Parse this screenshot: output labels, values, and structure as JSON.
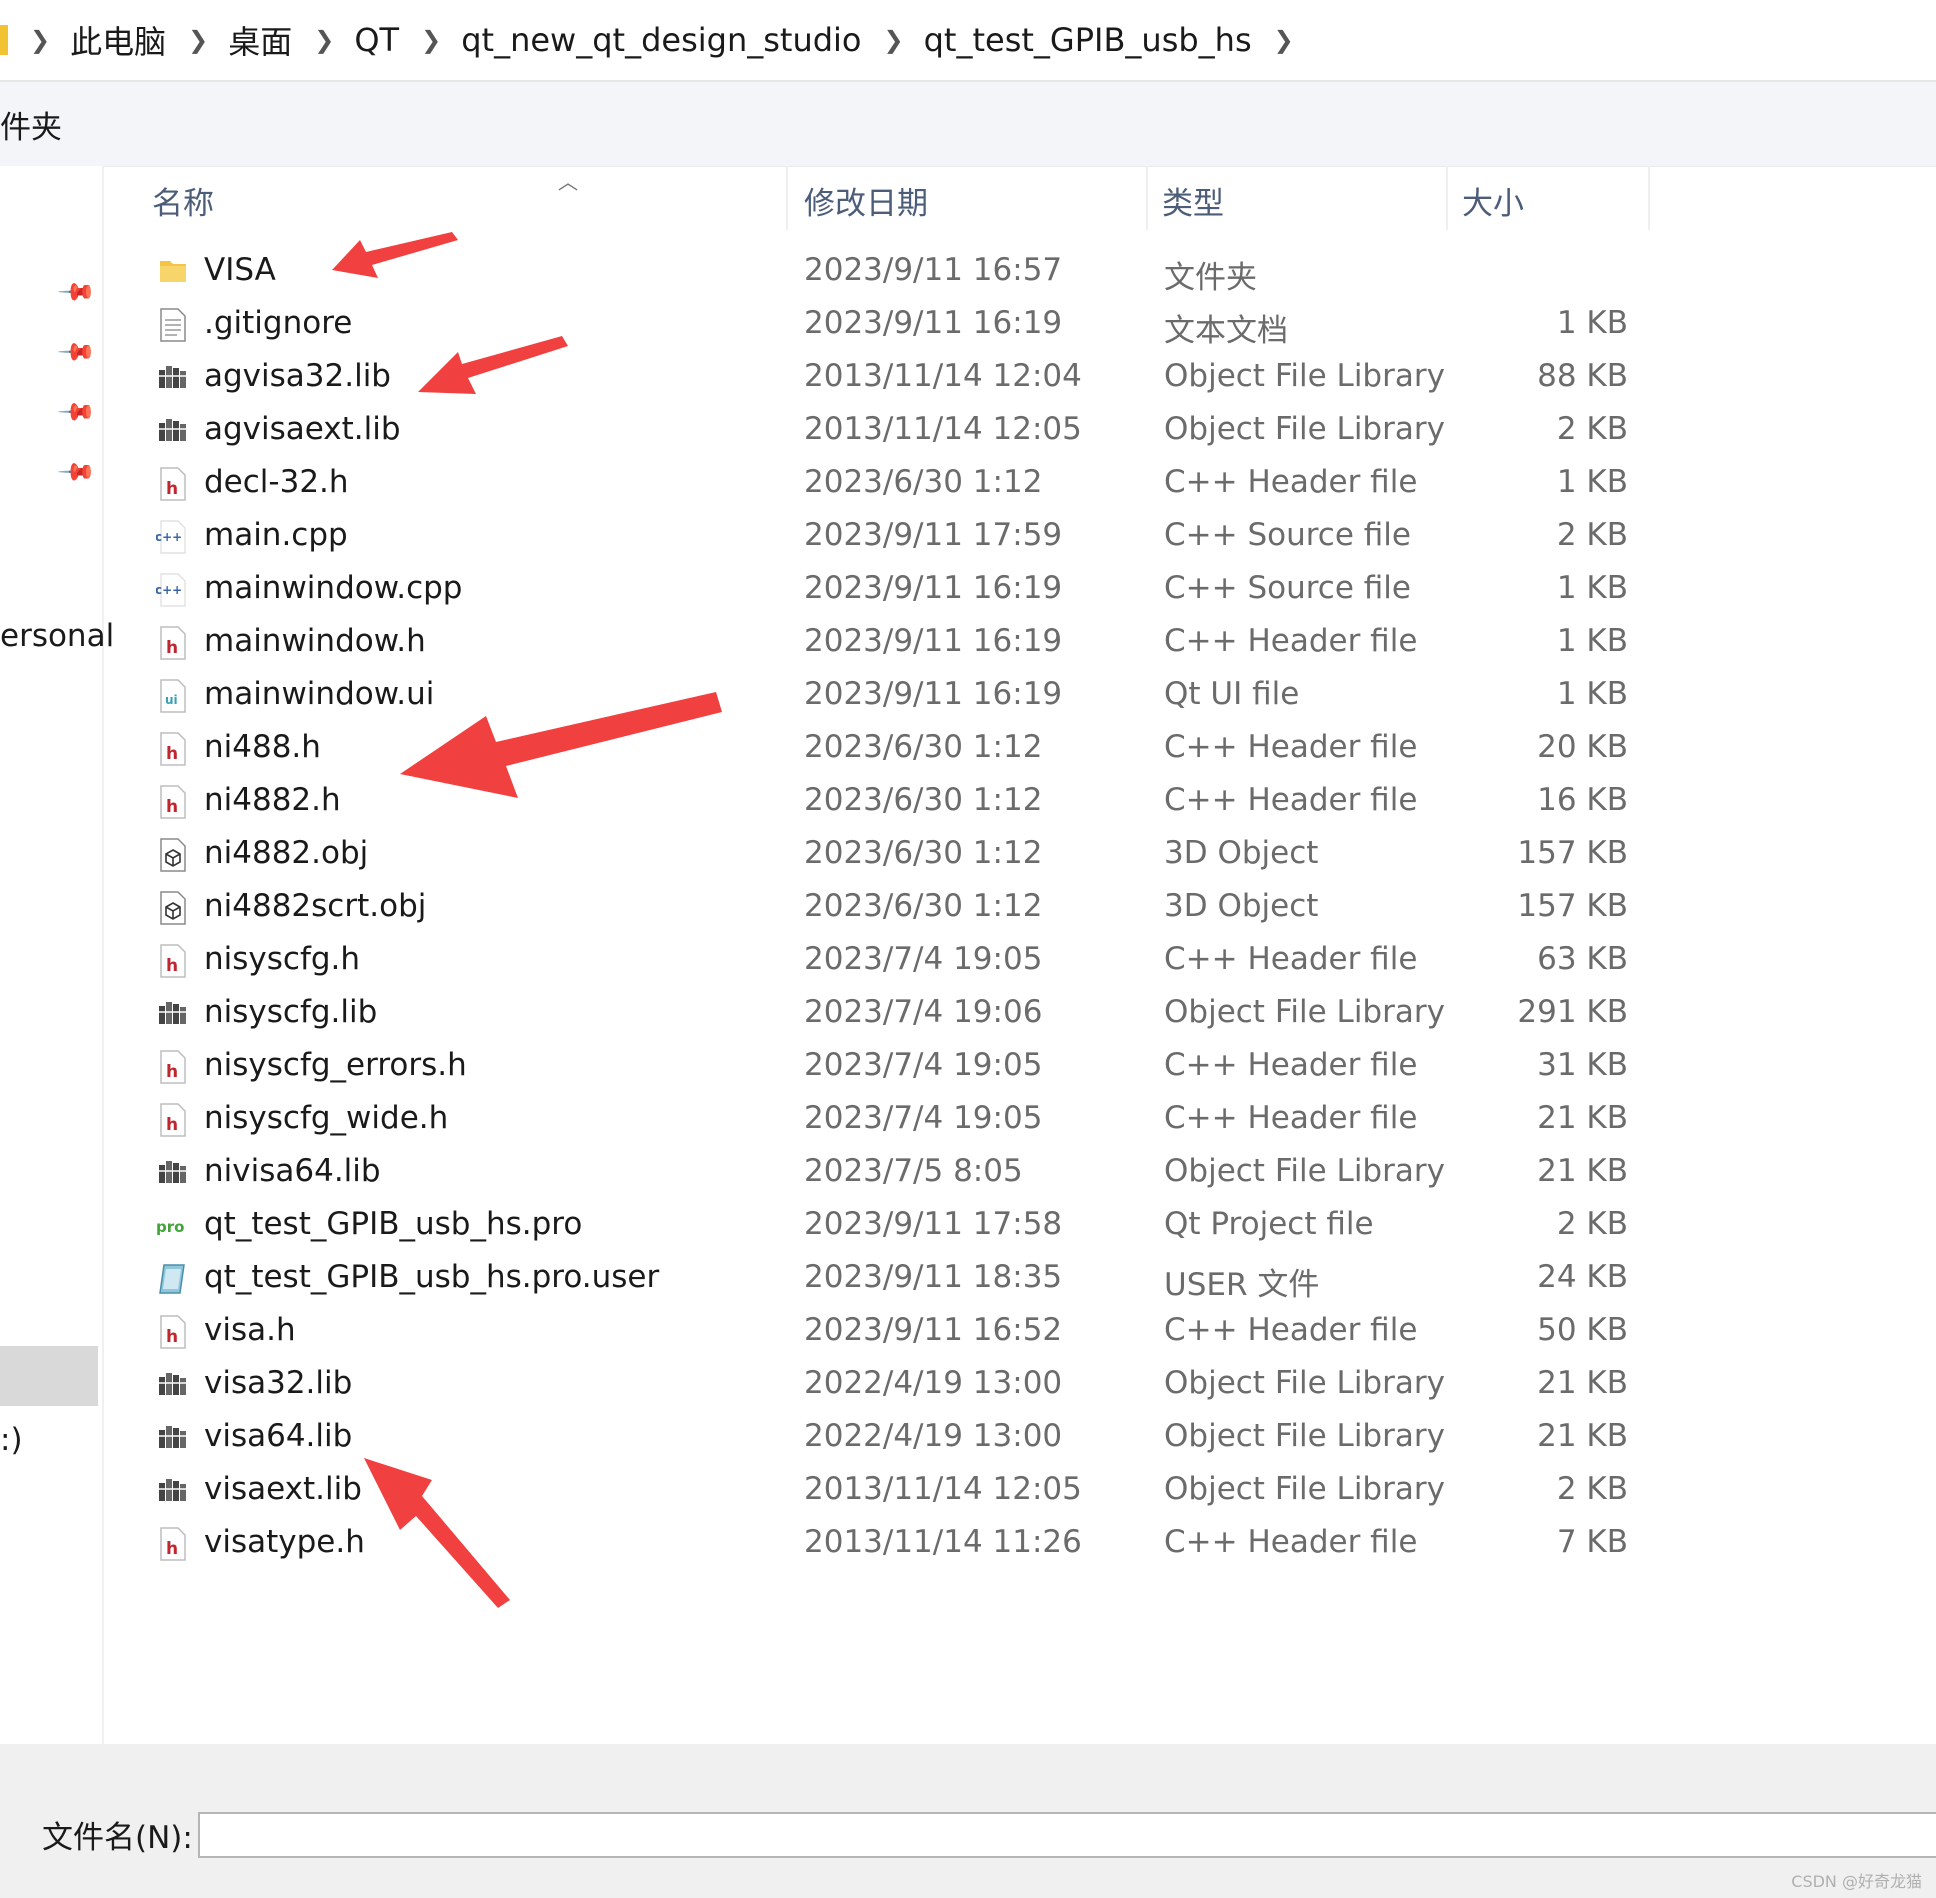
{
  "breadcrumb": [
    "此电脑",
    "桌面",
    "QT",
    "qt_new_qt_design_studio",
    "qt_test_GPIB_usb_hs"
  ],
  "command_bar": {
    "label": "件夹"
  },
  "nav": {
    "item_personal": "ersonal",
    "item_drive": ":)"
  },
  "columns": {
    "name": "名称",
    "date": "修改日期",
    "type": "类型",
    "size": "大小"
  },
  "files": [
    {
      "icon": "folder-icon",
      "name": "VISA",
      "date": "2023/9/11 16:57",
      "type": "文件夹",
      "size": ""
    },
    {
      "icon": "text-file-icon",
      "name": ".gitignore",
      "date": "2023/9/11 16:19",
      "type": "文本文档",
      "size": "1 KB"
    },
    {
      "icon": "library-icon",
      "name": "agvisa32.lib",
      "date": "2013/11/14 12:04",
      "type": "Object File Library",
      "size": "88 KB"
    },
    {
      "icon": "library-icon",
      "name": "agvisaext.lib",
      "date": "2013/11/14 12:05",
      "type": "Object File Library",
      "size": "2 KB"
    },
    {
      "icon": "header-file-icon",
      "name": "decl-32.h",
      "date": "2023/6/30 1:12",
      "type": "C++ Header file",
      "size": "1 KB"
    },
    {
      "icon": "cpp-file-icon",
      "name": "main.cpp",
      "date": "2023/9/11 17:59",
      "type": "C++ Source file",
      "size": "2 KB"
    },
    {
      "icon": "cpp-file-icon",
      "name": "mainwindow.cpp",
      "date": "2023/9/11 16:19",
      "type": "C++ Source file",
      "size": "1 KB"
    },
    {
      "icon": "header-file-icon",
      "name": "mainwindow.h",
      "date": "2023/9/11 16:19",
      "type": "C++ Header file",
      "size": "1 KB"
    },
    {
      "icon": "ui-file-icon",
      "name": "mainwindow.ui",
      "date": "2023/9/11 16:19",
      "type": "Qt UI file",
      "size": "1 KB"
    },
    {
      "icon": "header-file-icon",
      "name": "ni488.h",
      "date": "2023/6/30 1:12",
      "type": "C++ Header file",
      "size": "20 KB"
    },
    {
      "icon": "header-file-icon",
      "name": "ni4882.h",
      "date": "2023/6/30 1:12",
      "type": "C++ Header file",
      "size": "16 KB"
    },
    {
      "icon": "3d-object-icon",
      "name": "ni4882.obj",
      "date": "2023/6/30 1:12",
      "type": "3D Object",
      "size": "157 KB"
    },
    {
      "icon": "3d-object-icon",
      "name": "ni4882scrt.obj",
      "date": "2023/6/30 1:12",
      "type": "3D Object",
      "size": "157 KB"
    },
    {
      "icon": "header-file-icon",
      "name": "nisyscfg.h",
      "date": "2023/7/4 19:05",
      "type": "C++ Header file",
      "size": "63 KB"
    },
    {
      "icon": "library-icon",
      "name": "nisyscfg.lib",
      "date": "2023/7/4 19:06",
      "type": "Object File Library",
      "size": "291 KB"
    },
    {
      "icon": "header-file-icon",
      "name": "nisyscfg_errors.h",
      "date": "2023/7/4 19:05",
      "type": "C++ Header file",
      "size": "31 KB"
    },
    {
      "icon": "header-file-icon",
      "name": "nisyscfg_wide.h",
      "date": "2023/7/4 19:05",
      "type": "C++ Header file",
      "size": "21 KB"
    },
    {
      "icon": "library-icon",
      "name": "nivisa64.lib",
      "date": "2023/7/5 8:05",
      "type": "Object File Library",
      "size": "21 KB"
    },
    {
      "icon": "pro-file-icon",
      "name": "qt_test_GPIB_usb_hs.pro",
      "date": "2023/9/11 17:58",
      "type": "Qt Project file",
      "size": "2 KB"
    },
    {
      "icon": "user-file-icon",
      "name": "qt_test_GPIB_usb_hs.pro.user",
      "date": "2023/9/11 18:35",
      "type": "USER 文件",
      "size": "24 KB"
    },
    {
      "icon": "header-file-icon",
      "name": "visa.h",
      "date": "2023/9/11 16:52",
      "type": "C++ Header file",
      "size": "50 KB"
    },
    {
      "icon": "library-icon",
      "name": "visa32.lib",
      "date": "2022/4/19 13:00",
      "type": "Object File Library",
      "size": "21 KB"
    },
    {
      "icon": "library-icon",
      "name": "visa64.lib",
      "date": "2022/4/19 13:00",
      "type": "Object File Library",
      "size": "21 KB"
    },
    {
      "icon": "library-icon",
      "name": "visaext.lib",
      "date": "2013/11/14 12:05",
      "type": "Object File Library",
      "size": "2 KB"
    },
    {
      "icon": "header-file-icon",
      "name": "visatype.h",
      "date": "2013/11/14 11:26",
      "type": "C++ Header file",
      "size": "7 KB"
    }
  ],
  "filename_field": {
    "label": "文件名(N):",
    "value": ""
  },
  "watermark": "CSDN @好奇龙猫",
  "colors": {
    "arrow": "#f04040",
    "header_text": "#4b5d78",
    "secondary_text": "#6b6b6b"
  }
}
